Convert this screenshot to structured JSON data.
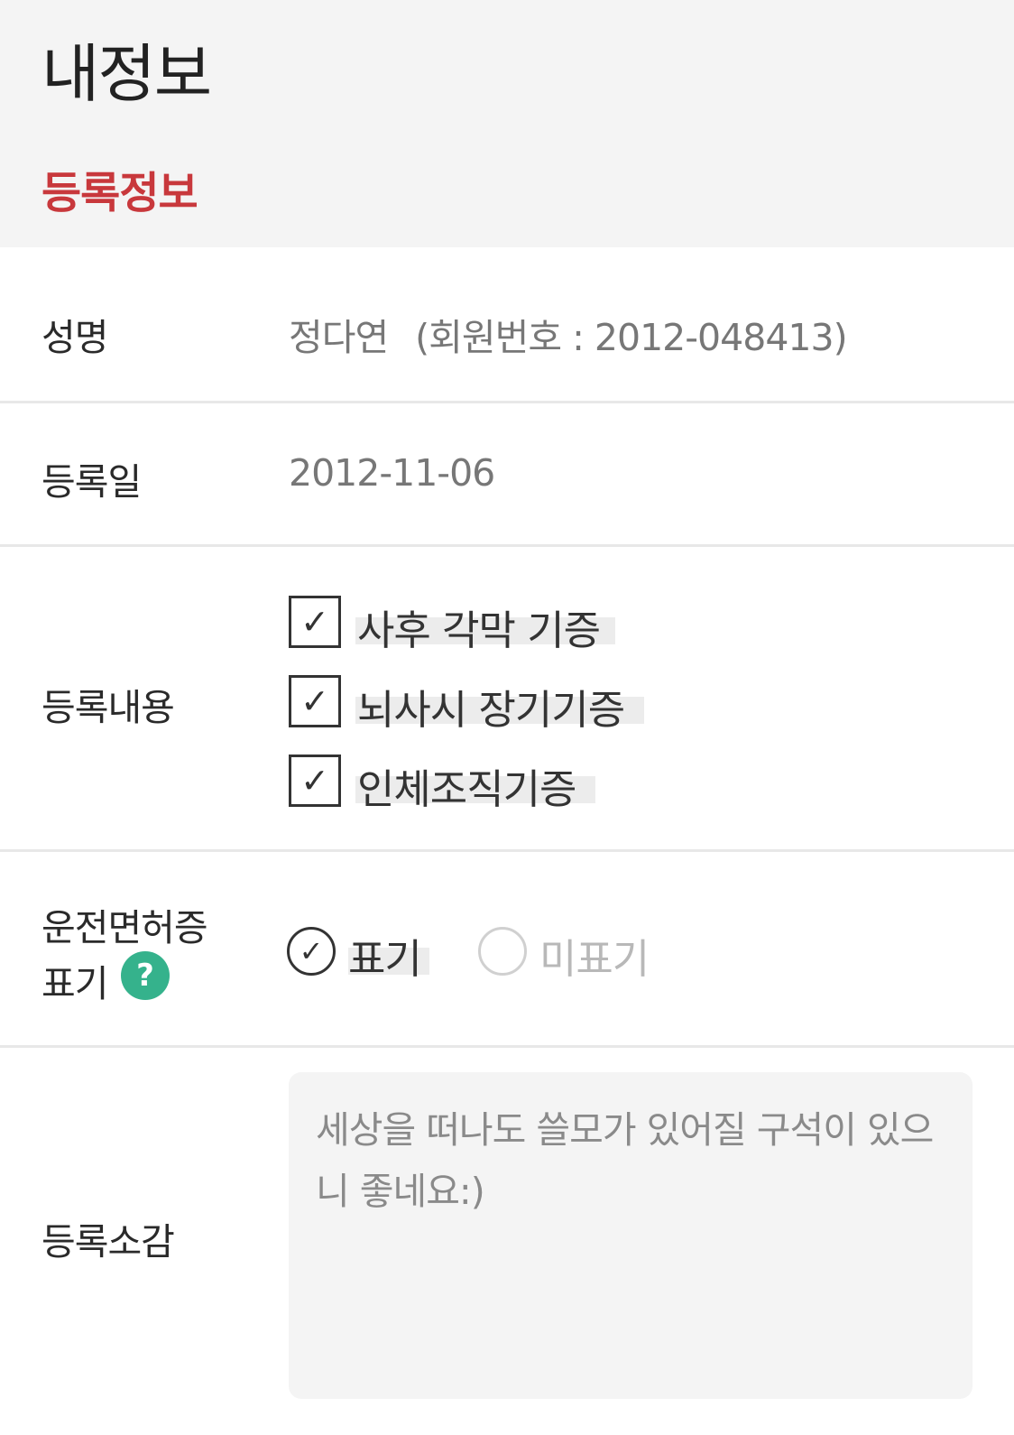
{
  "header": {
    "title": "내정보",
    "section_title": "등록정보"
  },
  "name_row": {
    "label": "성명",
    "name": "정다연",
    "member_no": "(회원번호 : 2012-048413)"
  },
  "date_row": {
    "label": "등록일",
    "value": "2012-11-06"
  },
  "content_row": {
    "label": "등록내용",
    "items": [
      {
        "label": "사후 각막 기증",
        "checked": true
      },
      {
        "label": "뇌사시 장기기증",
        "checked": true
      },
      {
        "label": "인체조직기증",
        "checked": true
      }
    ]
  },
  "license_row": {
    "label_line1": "운전면허증",
    "label_line2": "표기",
    "help_icon": "question-icon",
    "help_color": "#35b28c",
    "options": [
      {
        "label": "표기",
        "selected": true
      },
      {
        "label": "미표기",
        "selected": false
      }
    ]
  },
  "comment_row": {
    "label": "등록소감",
    "value": "세상을 떠나도 쓸모가 있어질 구석이 있으니 좋네요:)"
  },
  "colors": {
    "accent": "#c8383c",
    "header_bg": "#f4f4f4"
  }
}
